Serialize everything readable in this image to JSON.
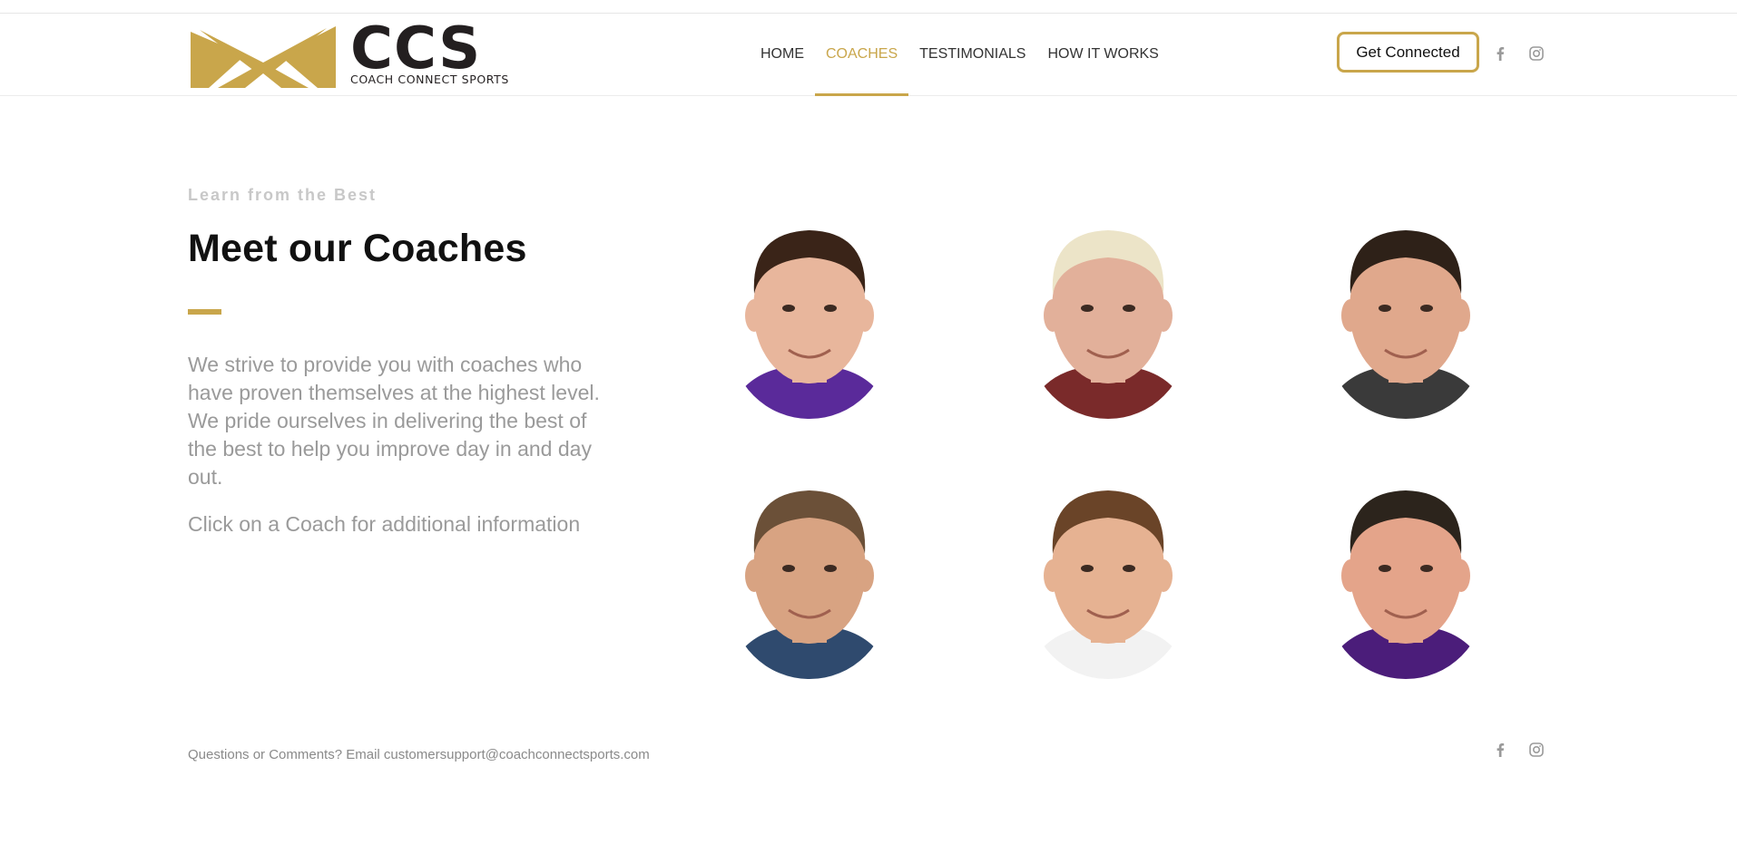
{
  "brand": {
    "name": "CCS",
    "tagline": "COACH CONNECT SPORTS",
    "accent_color": "#c9a64b",
    "dark_color": "#231f20"
  },
  "nav": {
    "items": [
      {
        "label": "HOME",
        "active": false
      },
      {
        "label": "COACHES",
        "active": true
      },
      {
        "label": "TESTIMONIALS",
        "active": false
      },
      {
        "label": "HOW IT WORKS",
        "active": false
      }
    ],
    "cta_label": "Get Connected"
  },
  "social_icons": [
    "facebook-icon",
    "instagram-icon"
  ],
  "hero": {
    "eyebrow": "Learn from the Best",
    "title": "Meet our Coaches",
    "description": "We strive to provide you with coaches who have proven themselves at the highest level. We pride ourselves in delivering the best of the best to help you improve day in and day out.",
    "hint": "Click on a Coach for additional information"
  },
  "coaches": [
    {
      "hair": "#3a2418",
      "skin": "#e8b69c",
      "shirt": "#5a2a9a"
    },
    {
      "hair": "#ece4c8",
      "skin": "#e2b09a",
      "shirt": "#7a2a2a"
    },
    {
      "hair": "#2e2118",
      "skin": "#e0a88c",
      "shirt": "#3a3a3a"
    },
    {
      "hair": "#6b5038",
      "skin": "#d8a382",
      "shirt": "#2f4a6e"
    },
    {
      "hair": "#6a4428",
      "skin": "#e6b292",
      "shirt": "#f2f2f2"
    },
    {
      "hair": "#2c241c",
      "skin": "#e4a48a",
      "shirt": "#4b1d7a"
    }
  ],
  "footer": {
    "contact_text": "Questions or Comments? Email customersupport@coachconnectsports.com"
  }
}
